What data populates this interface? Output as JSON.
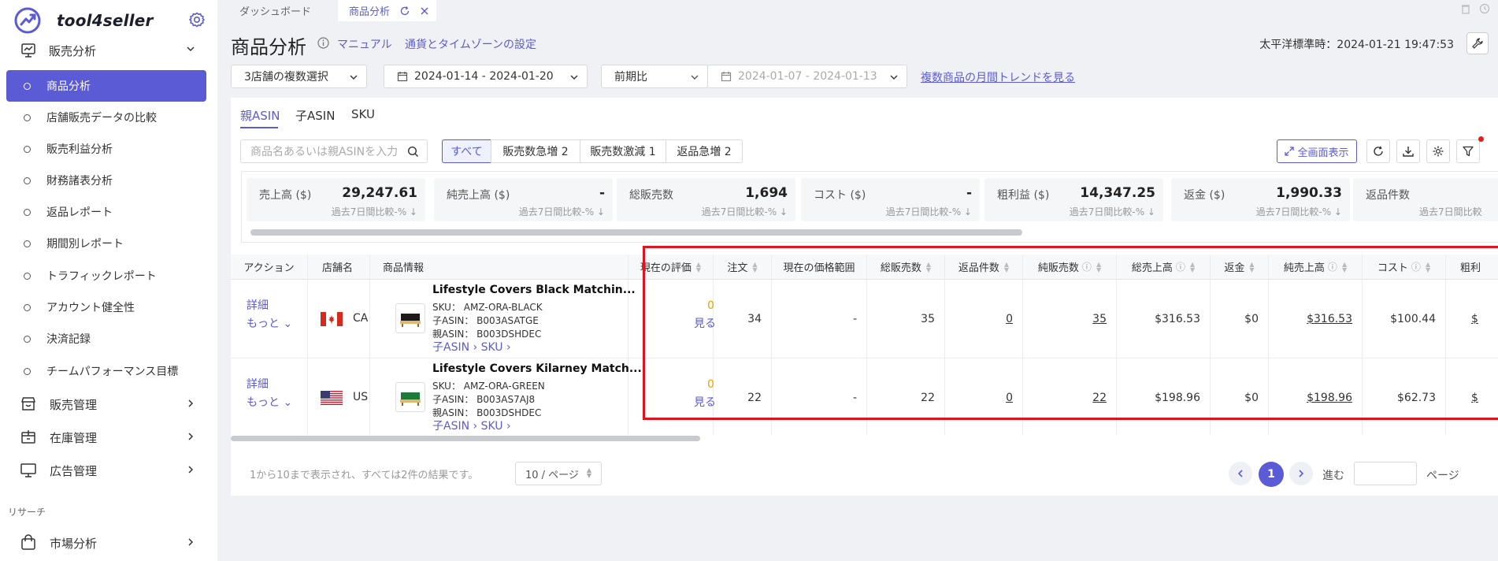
{
  "brand": {
    "name": "tool4seller"
  },
  "sidebar": {
    "group_open": {
      "label": "販売分析"
    },
    "items": [
      {
        "label": "商品分析",
        "active": true
      },
      {
        "label": "店舗販売データの比較"
      },
      {
        "label": "販売利益分析"
      },
      {
        "label": "財務諸表分析"
      },
      {
        "label": "返品レポート"
      },
      {
        "label": "期間別レポート"
      },
      {
        "label": "トラフィックレポート"
      },
      {
        "label": "アカウント健全性"
      },
      {
        "label": "決済記録"
      },
      {
        "label": "チームパフォーマンス目標"
      }
    ],
    "groups": [
      {
        "label": "販売管理",
        "icon": "store-icon"
      },
      {
        "label": "在庫管理",
        "icon": "inventory-icon"
      },
      {
        "label": "広告管理",
        "icon": "monitor-icon"
      }
    ],
    "section_research": "リサーチ",
    "market": {
      "label": "市場分析",
      "icon": "shopping-bag-icon"
    }
  },
  "tabs": {
    "dashboard": "ダッシュボード",
    "current": "商品分析"
  },
  "header": {
    "title": "商品分析",
    "manual_link": "マニュアル",
    "settings_link": "通貨とタイムゾーンの設定",
    "timezone": "太平洋標準時：2024-01-21 19:47:53"
  },
  "filters": {
    "stores": "3店舗の複数選択",
    "date_range": "2024-01-14 - 2024-01-20",
    "compare": "前期比",
    "compare_range": "2024-01-07 - 2024-01-13",
    "trend_link": "複数商品の月間トレンドを見る"
  },
  "asin_tabs": [
    "親ASIN",
    "子ASIN",
    "SKU"
  ],
  "search": {
    "placeholder": "商品名あるいは親ASINを入力"
  },
  "segments": [
    "すべて",
    "販売数急増 2",
    "販売数激減 1",
    "返品急増 2"
  ],
  "fullscreen_label": "全画面表示",
  "kpis": [
    {
      "label": "売上高 ($)",
      "value": "29,247.61",
      "compare": "過去7日間比較-% ↓"
    },
    {
      "label": "純売上高 ($)",
      "value": "-",
      "compare": "過去7日間比較-% ↓"
    },
    {
      "label": "総販売数",
      "value": "1,694",
      "compare": "過去7日間比較-% ↓"
    },
    {
      "label": "コスト ($)",
      "value": "-",
      "compare": "過去7日間比較-% ↓"
    },
    {
      "label": "粗利益 ($)",
      "value": "14,347.25",
      "compare": "過去7日間比較-% ↓"
    },
    {
      "label": "返金 ($)",
      "value": "1,990.33",
      "compare": "過去7日間比較-% ↓"
    },
    {
      "label": "返品件数",
      "value": "",
      "compare": "過去7日間比較"
    }
  ],
  "columns": [
    "アクション",
    "店舗名",
    "商品情報",
    "現在の評価",
    "注文",
    "現在の価格範囲",
    "総販売数",
    "返品件数",
    "純販売数",
    "総売上高",
    "返金",
    "純売上高",
    "コスト",
    "粗利"
  ],
  "rows": [
    {
      "detail": "詳細",
      "more": "もっと ⌄",
      "country": "CA",
      "name": "Lifestyle Covers Black Matchin...",
      "sku": "SKU：  AMZ-ORA-BLACK",
      "child_asin": "子ASIN：  B003ASATGE",
      "parent_asin": "親ASIN：  B003DSHDEC",
      "links": "子ASIN ›    SKU ›",
      "rating": "0",
      "view": "見る",
      "orders": "34",
      "price": "-",
      "total_sold": "35",
      "returns": "0",
      "net_sold": "35",
      "gross": "$316.53",
      "refund": "$0",
      "net_sales": "$316.53",
      "cost": "$100.44",
      "profit": "$"
    },
    {
      "detail": "詳細",
      "more": "もっと ⌄",
      "country": "US",
      "name": "Lifestyle Covers Kilarney Match...",
      "sku": "SKU：  AMZ-ORA-GREEN",
      "child_asin": "子ASIN：  B003AS7AJ8",
      "parent_asin": "親ASIN：  B003DSHDEC",
      "links": "子ASIN ›    SKU ›",
      "rating": "0",
      "view": "見る",
      "orders": "22",
      "price": "-",
      "total_sold": "22",
      "returns": "0",
      "net_sold": "22",
      "gross": "$198.96",
      "refund": "$0",
      "net_sales": "$198.96",
      "cost": "$62.73",
      "profit": "$"
    }
  ],
  "footer": {
    "info": "1から10まで表示され、すべては2件の結果です。",
    "page_size": "10 / ページ",
    "current_page": "1",
    "goto_label": "進む",
    "page_suffix": "ページ"
  },
  "colors": {
    "accent": "#5b5bd6",
    "highlight": "#e0141e",
    "rating": "#f0a000"
  }
}
